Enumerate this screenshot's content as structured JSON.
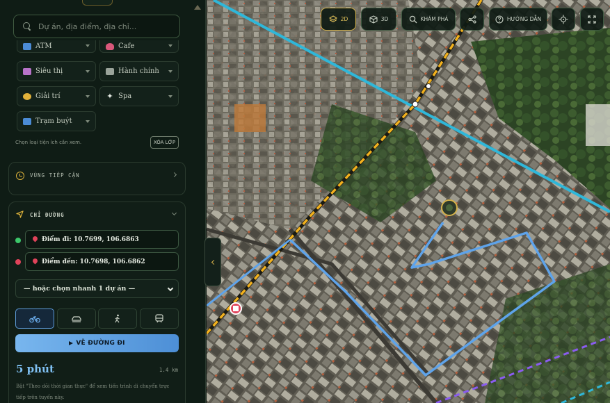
{
  "search": {
    "placeholder": "Dự án, địa điểm, địa chỉ..."
  },
  "amenities": [
    {
      "label": "ATM",
      "icon": "atm-icon",
      "color": "#4b8bd6"
    },
    {
      "label": "Cafe",
      "icon": "cafe-icon",
      "color": "#d9577a"
    },
    {
      "label": "Siêu thị",
      "icon": "cart-icon",
      "color": "#b873c9"
    },
    {
      "label": "Hành chính",
      "icon": "building-icon",
      "color": "#9aa39a"
    },
    {
      "label": "Giải trí",
      "icon": "theater-icon",
      "color": "#e2b23a"
    },
    {
      "label": "Spa",
      "icon": "sparkle-icon",
      "color": "#e6ece4"
    },
    {
      "label": "Trạm buýt",
      "icon": "bus-icon",
      "color": "#4b8bd6"
    }
  ],
  "amenity_hint": "Chọn loại tiện ích cần xem.",
  "clear_label": "XÓA LỚP",
  "reach_panel": {
    "title": "VÙNG TIẾP CẬN"
  },
  "route_panel": {
    "title": "CHỈ ĐƯỜNG",
    "origin": "Điểm đi: 10.7699, 106.6863",
    "destination": "Điểm đến: 10.7698, 106.6862",
    "quick_select": "— hoặc chọn nhanh 1 dự án —",
    "modes": [
      "bike-icon",
      "car-icon",
      "walk-icon",
      "transit-icon"
    ],
    "active_mode": 0,
    "draw_label": "VẼ ĐƯỜNG ĐI",
    "eta": "5 phút",
    "distance": "1.4 km",
    "note": "Bật \"Theo dõi thời gian thực\" để xem tiến trình di chuyển trực tiếp trên tuyến này."
  },
  "toolbar": {
    "btn_2d": "2D",
    "btn_3d": "3D",
    "explore": "KHÁM PHÁ",
    "guide": "HƯỚNG DẪN"
  },
  "colors": {
    "accent_gold": "#d4b24a",
    "route_blue": "#5ea3ea",
    "start_dot": "#3cc76a",
    "end_dot": "#e0435a"
  }
}
